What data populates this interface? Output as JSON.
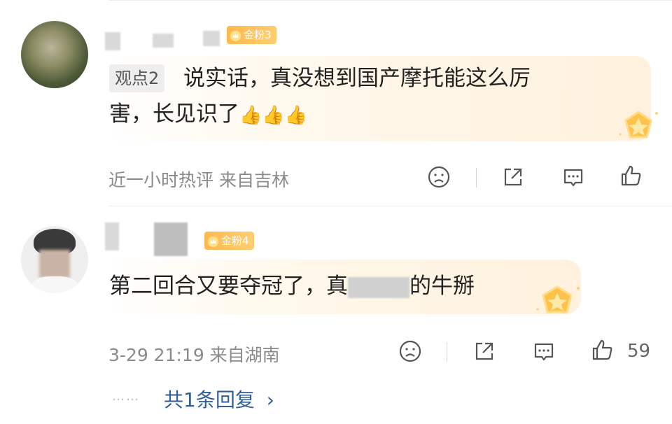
{
  "comments": [
    {
      "badge": "金粉3",
      "tag": "观点2",
      "text_line1": "说实话，真没想到国产摩托能这么厉",
      "text_line2": "害，长见识了",
      "emoji": "👍👍👍",
      "meta": "近一小时热评 来自吉林",
      "like_count": ""
    },
    {
      "badge": "金粉4",
      "text_before": "第二回合又要夺冠了，真",
      "text_after": "的牛掰",
      "meta": "3-29 21:19 来自湖南",
      "like_count": "59",
      "replies_label": "共1条回复",
      "replies_arrow": "›",
      "replies_dots": "……"
    }
  ],
  "icons": {
    "sad": "sad-face-icon",
    "share": "share-icon",
    "comment": "comment-icon",
    "like": "thumbs-up-icon"
  },
  "colors": {
    "badge": "#ffb84d",
    "reply_link": "#2f5e99",
    "meta_text": "#8a8a8a"
  }
}
